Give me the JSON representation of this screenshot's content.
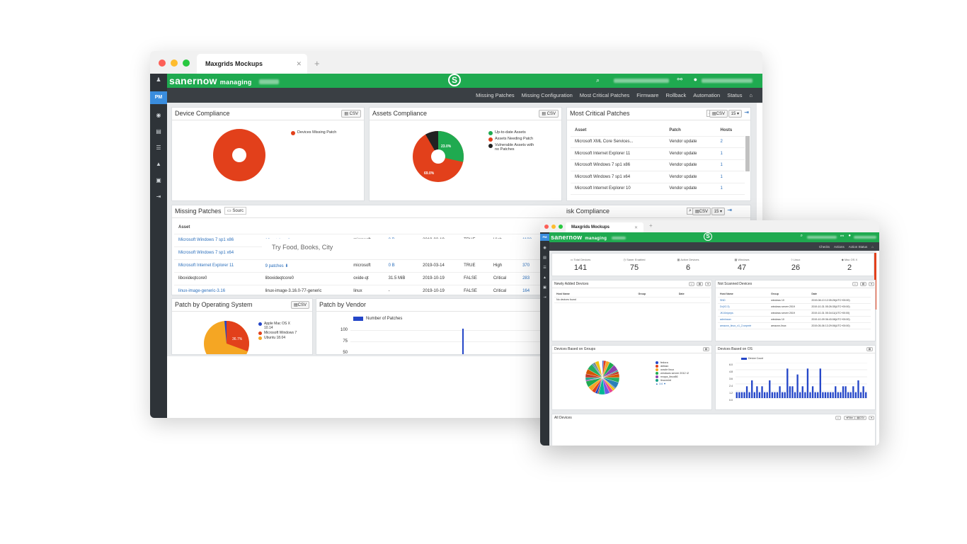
{
  "big": {
    "tab_title": "Maxgrids Mockups",
    "brand": "sanernow",
    "managing": "managing",
    "nav": [
      "Missing Patches",
      "Missing Configuration",
      "Most Critical Patches",
      "Firmware",
      "Rollback",
      "Automation",
      "Status"
    ],
    "sidebar_pm": "PM",
    "csv": "CSV",
    "device_compliance": {
      "title": "Device Compliance",
      "legend": "Devices Missing Patch"
    },
    "assets_compliance": {
      "title": "Assets Compliance",
      "legend": [
        "Up-to-date Assets",
        "Assets Needing Patch",
        "Vulnerable Assets with no Patches"
      ],
      "pct_green": "23.0%",
      "pct_red": "69.0%"
    },
    "critical": {
      "title": "Most Critical Patches",
      "page_size": "15",
      "headers": [
        "Asset",
        "Patch",
        "Hosts"
      ],
      "rows": [
        [
          "Microsoft XML Core Services...",
          "Vendor update",
          "2"
        ],
        [
          "Microsoft Internet Explorer 11",
          "Vendor update",
          "1"
        ],
        [
          "Microsoft Windows 7 sp1 x86",
          "Vendor update",
          "1"
        ],
        [
          "Microsoft Windows 7 sp1 x64",
          "Vendor update",
          "1"
        ],
        [
          "Microsoft Internet Explorer 10",
          "Vendor update",
          "1"
        ]
      ]
    },
    "missing": {
      "title": "Missing Patches",
      "source": "Sourc",
      "header": "Asset",
      "rows": [
        [
          "Microsoft Windows 7 sp1 x86",
          "16 patches ⬇",
          "microsoft",
          "0 B",
          "2019-03-19",
          "TRUE",
          "High",
          "1108"
        ],
        [
          "Microsoft Windows 7 sp1 x64",
          "16 patches ⬇",
          "microsoft",
          "0 B",
          "2019-03-19",
          "TRUE",
          "High",
          "794"
        ],
        [
          "Microsoft Internet Explorer 11",
          "9 patches ⬇",
          "microsoft",
          "0 B",
          "2019-03-14",
          "TRUE",
          "High",
          "370"
        ],
        [
          "liboxideqtcore0",
          "liboxideqtcore0",
          "oxide-qt",
          "31.5 MiB",
          "2019-10-19",
          "FALSE",
          "Critical",
          "283"
        ],
        [
          "linux-image-generic-3.16",
          "linux-image-3.16.0-77-generic",
          "linux",
          "-",
          "2019-10-19",
          "FALSE",
          "Critical",
          "164"
        ]
      ]
    },
    "risk": {
      "title": "isk Compliance",
      "page_size": "15"
    },
    "search_placeholder": "Try Food, Books, City",
    "pbos": {
      "title": "Patch by Operating System",
      "legend": [
        "Apple Mac OS X 10.14",
        "Microsoft Windows 7",
        "Ubuntu 18.04"
      ],
      "pct": "36.7%"
    },
    "pbv": {
      "title": "Patch by Vendor",
      "series": "Number of Patches",
      "ticks": [
        "100",
        "75",
        "50"
      ]
    }
  },
  "small": {
    "tab_title": "Maxgrids Mockups",
    "brand": "sanernow",
    "managing": "managing",
    "nav": [
      "Checks",
      "Actions",
      "Action Status"
    ],
    "sidebar_pm": "PM",
    "stats": [
      {
        "label": "Total Devices",
        "value": "141"
      },
      {
        "label": "Saner Enabled",
        "value": "75"
      },
      {
        "label": "Active Devices",
        "value": "6"
      },
      {
        "label": "Windows",
        "value": "47"
      },
      {
        "label": "Linux",
        "value": "26"
      },
      {
        "label": "Mac OS X",
        "value": "2"
      }
    ],
    "newly": {
      "title": "Newly Added Devices",
      "headers": [
        "Host Name",
        "Group",
        "Date"
      ],
      "empty": "No devices found"
    },
    "notscanned": {
      "title": "Not Scanned Devices",
      "headers": [
        "Host Name",
        "Group",
        "Date"
      ],
      "rows": [
        [
          "SND",
          "windows 10",
          "2019-08-13 12:05:26(UTC+00:00)"
        ],
        [
          "Dr(X2.3)",
          "windows server 2019",
          "2019-10-31 05:26:35(UTC+00:00)"
        ],
        [
          "JK10nipeps",
          "windows server 2019",
          "2019-10-31 05:34:11(UTC+00:00)"
        ],
        [
          "adminsan",
          "windows 10",
          "2019-10-09 06:43:08(UTC+00:00)"
        ],
        [
          "amazon_linux_v1_2-snpmtr",
          "amazon-linux",
          "2019-05-06 13:29:06(UTC+00:00)"
        ]
      ]
    },
    "groups": {
      "title": "Devices Based on Groups",
      "legend": [
        "fedora",
        "debian",
        "oracle linux",
        "windows server 2012 r2",
        "nvopa_linux86",
        "linuxmint"
      ],
      "pager": "1/4"
    },
    "os": {
      "title": "Devices Based on OS",
      "series": "Device Count",
      "ticks": [
        "6.0",
        "4.8",
        "3.6",
        "2.4",
        "1.2",
        "0.0"
      ],
      "values": [
        1,
        1,
        1,
        1,
        2,
        1,
        3,
        1,
        2,
        1,
        2,
        1,
        1,
        3,
        1,
        1,
        1,
        2,
        1,
        1,
        5,
        2,
        2,
        1,
        4,
        1,
        2,
        1,
        5,
        1,
        2,
        1,
        1,
        5,
        1,
        1,
        1,
        1,
        1,
        2,
        1,
        1,
        2,
        2,
        1,
        1,
        2,
        1,
        3,
        1,
        2,
        1
      ]
    },
    "alldevices": {
      "title": "All Devices",
      "filter": "Filter",
      "csv": "CSV"
    }
  },
  "colors": {
    "green": "#1faa50",
    "red": "#e2401b",
    "dark": "#2e3338",
    "blue": "#2446c8",
    "orange": "#f5a623"
  }
}
